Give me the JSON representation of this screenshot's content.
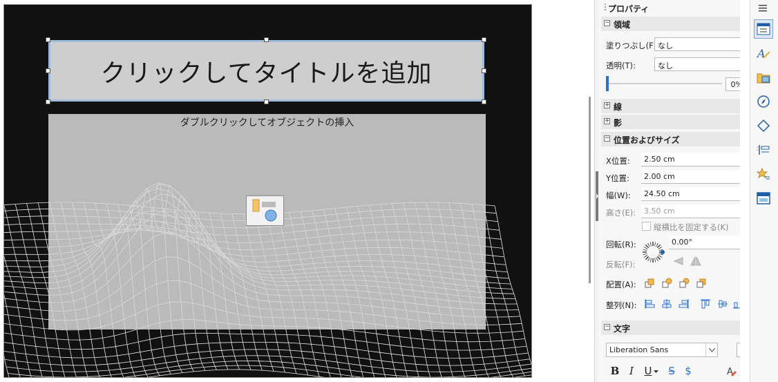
{
  "slide": {
    "title_placeholder": "クリックしてタイトルを追加",
    "content_placeholder": "ダブルクリックしてオブジェクトの挿入"
  },
  "sidebar": {
    "title": "プロパティ",
    "sections": {
      "area": {
        "label": "領域",
        "fill_label": "塗りつぶし(F):",
        "fill_value": "なし",
        "transparency_label": "透明(T):",
        "transparency_value": "なし",
        "transparency_percent": "0%",
        "transparency_level": 0
      },
      "line": {
        "label": "線"
      },
      "shadow": {
        "label": "影"
      },
      "position_size": {
        "label": "位置およびサイズ",
        "x_label": "X位置:",
        "x_value": "2.50 cm",
        "y_label": "Y位置:",
        "y_value": "2.00 cm",
        "width_label": "幅(W):",
        "width_value": "24.50 cm",
        "height_label": "高さ(E):",
        "height_value": "3.50 cm",
        "keep_ratio_label": "縦横比を固定する(K)",
        "rotation_label": "回転(R):",
        "rotation_value": "0.00°",
        "flip_label": "反転(F):",
        "arrange_label": "配置(A):",
        "align_label": "整列(N):"
      },
      "character": {
        "label": "文字",
        "font_name": "Liberation Sans",
        "format_buttons": [
          "B",
          "I",
          "U",
          "S",
          "$"
        ]
      }
    }
  },
  "tabs": [
    "properties-tab",
    "styles-tab",
    "gallery-tab",
    "navigator-tab",
    "shapes-tab",
    "slide-transition-tab",
    "animation-tab",
    "master-slides-tab"
  ],
  "colors": {
    "accent": "#2a72d0",
    "selection_border": "#9fbcdc"
  }
}
